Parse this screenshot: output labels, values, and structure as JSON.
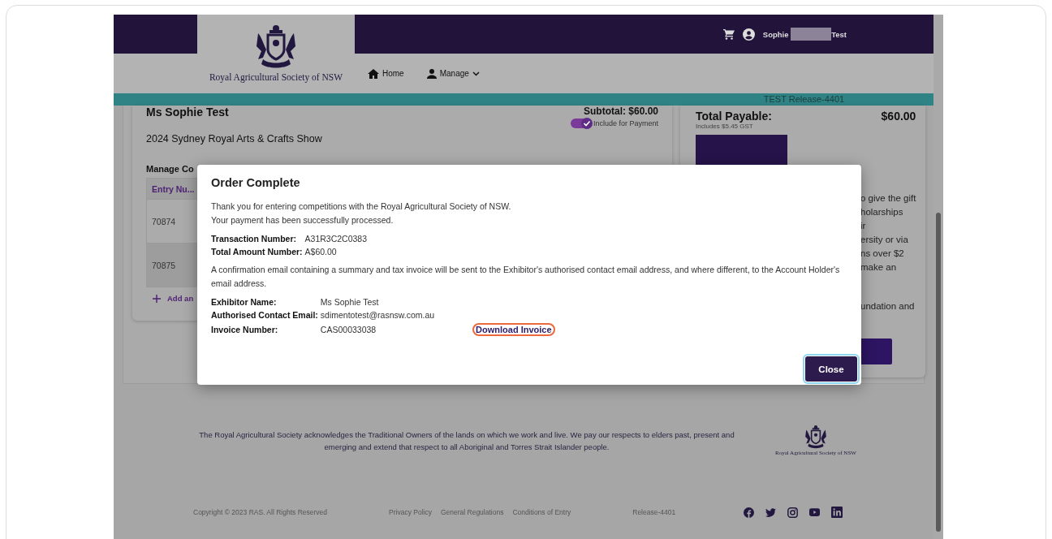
{
  "header": {
    "logo_text": "Royal Agricultural Society of NSW",
    "user": {
      "first_name": "Sophie",
      "last_name": "Test"
    }
  },
  "nav": [
    {
      "kind": "home",
      "label": "Home"
    },
    {
      "kind": "manage",
      "label": "Manage"
    }
  ],
  "environment_banner": "TEST Release-4401",
  "order": {
    "exhibitor": "Ms Sophie Test",
    "subtotal": "Subtotal: $60.00",
    "include_for_payment": {
      "label": "Include for Payment",
      "on": true
    },
    "show": "2024 Sydney Royal Arts & Crafts Show",
    "section_title": "Manage Co",
    "table": {
      "columns": [
        "Entry Nu..."
      ],
      "rows": [
        {
          "cells": [
            "70874"
          ],
          "selected": false
        },
        {
          "cells": [
            "70875"
          ],
          "selected": true
        }
      ]
    },
    "add_link": "Add an"
  },
  "summary": {
    "title": "Total Payable:",
    "amount": "$60.00",
    "gst_note": "Includes $5.45 GST",
    "info_paragraphs": [
      [
        "o give the gift",
        "holarships",
        "ir",
        "ersity or via",
        "ns over $2",
        "make an"
      ],
      [
        "undation and"
      ]
    ]
  },
  "modal": {
    "title": "Order Complete",
    "intro": [
      "Thank you for entering competitions with the Royal Agricultural Society of NSW.",
      "Your payment has been successfully processed."
    ],
    "payment_fields": [
      {
        "label": "Transaction Number:",
        "value": "A31R3C2C0383"
      },
      {
        "label": "Total Amount Number:",
        "value": "A$60.00"
      }
    ],
    "notice": "A confirmation email containing a summary and tax invoice will be sent to the Exhibitor's authorised contact email address, and where different, to the Account Holder's email address.",
    "detail_fields": [
      {
        "label": "Exhibitor Name:",
        "value": "Ms Sophie Test"
      },
      {
        "label": "Authorised Contact Email:",
        "value": "sdimentotest@rasnsw.com.au"
      },
      {
        "label": "Invoice Number:",
        "value": "CAS00033038",
        "link": "Download Invoice"
      }
    ],
    "close_button": "Close"
  },
  "footer": {
    "acknowledgement": "The Royal Agricultural Society acknowledges the Traditional Owners of the lands on which we work and live. We pay our respects to elders past, present and emerging and extend that respect to all Aboriginal and Torres Strait Islander people.",
    "logo_text": "Royal Agricultural Society of NSW",
    "copyright": "Copyright © 2023 RAS. All Rights Reserved",
    "links": [
      "Privacy Policy",
      "General Regulations",
      "Conditions of Entry"
    ],
    "release": "Release-4401",
    "social": [
      {
        "kind": "facebook"
      },
      {
        "kind": "twitter"
      },
      {
        "kind": "instagram"
      },
      {
        "kind": "youtube"
      },
      {
        "kind": "linkedin"
      }
    ]
  }
}
